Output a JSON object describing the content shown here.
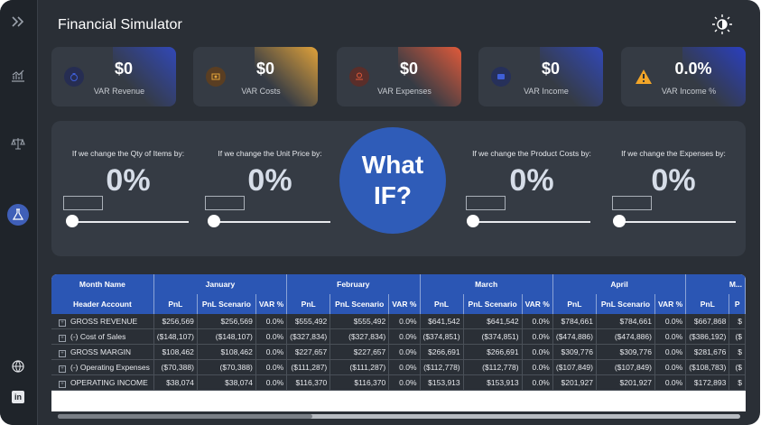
{
  "app": {
    "title": "Financial Simulator"
  },
  "sidebar": {
    "items": [
      {
        "name": "expand-icon",
        "glyph": "»"
      },
      {
        "name": "chart-icon",
        "glyph": "📈"
      },
      {
        "name": "scales-icon",
        "glyph": "⚖"
      },
      {
        "name": "flask-icon",
        "glyph": "⚗"
      },
      {
        "name": "globe-icon",
        "glyph": "🌐"
      },
      {
        "name": "linkedin-icon",
        "glyph": "in"
      }
    ]
  },
  "kpis": [
    {
      "value": "$0",
      "label": "VAR Revenue",
      "icon": "money-bag-icon",
      "accent": "#3148b8"
    },
    {
      "value": "$0",
      "label": "VAR Costs",
      "icon": "coin-icon",
      "accent": "#e0a23a"
    },
    {
      "value": "$0",
      "label": "VAR Expenses",
      "icon": "hand-coin-icon",
      "accent": "#e05a3a"
    },
    {
      "value": "$0",
      "label": "VAR Income",
      "icon": "wallet-icon",
      "accent": "#3148b8"
    },
    {
      "value": "0.0%",
      "label": "VAR Income %",
      "icon": "warning-icon",
      "accent": "#2a3fc0"
    }
  ],
  "controls": [
    {
      "question": "If we change the Qty of Items by:",
      "value": "0%"
    },
    {
      "question": "If we change the Unit Price by:",
      "value": "0%"
    },
    {
      "question": "If we change the Product Costs by:",
      "value": "0%"
    },
    {
      "question": "If we change the Expenses by:",
      "value": "0%"
    }
  ],
  "whatif": {
    "line1": "What",
    "line2": "IF?"
  },
  "table": {
    "header1_label": "Month Name",
    "header2_label": "Header Account",
    "months": [
      "January",
      "February",
      "March",
      "April",
      "M..."
    ],
    "subcols": [
      "PnL",
      "PnL Scenario",
      "VAR %"
    ],
    "rows": [
      {
        "account": "GROSS REVENUE",
        "cells": [
          "$256,569",
          "$256,569",
          "0.0%",
          "$555,492",
          "$555,492",
          "0.0%",
          "$641,542",
          "$641,542",
          "0.0%",
          "$784,661",
          "$784,661",
          "0.0%",
          "$667,868",
          "$"
        ]
      },
      {
        "account": "(-) Cost of Sales",
        "cells": [
          "($148,107)",
          "($148,107)",
          "0.0%",
          "($327,834)",
          "($327,834)",
          "0.0%",
          "($374,851)",
          "($374,851)",
          "0.0%",
          "($474,886)",
          "($474,886)",
          "0.0%",
          "($386,192)",
          "($"
        ]
      },
      {
        "account": "GROSS MARGIN",
        "cells": [
          "$108,462",
          "$108,462",
          "0.0%",
          "$227,657",
          "$227,657",
          "0.0%",
          "$266,691",
          "$266,691",
          "0.0%",
          "$309,776",
          "$309,776",
          "0.0%",
          "$281,676",
          "$"
        ]
      },
      {
        "account": "(-) Operating Expenses",
        "cells": [
          "($70,388)",
          "($70,388)",
          "0.0%",
          "($111,287)",
          "($111,287)",
          "0.0%",
          "($112,778)",
          "($112,778)",
          "0.0%",
          "($107,849)",
          "($107,849)",
          "0.0%",
          "($108,783)",
          "($"
        ]
      },
      {
        "account": "OPERATING INCOME",
        "cells": [
          "$38,074",
          "$38,074",
          "0.0%",
          "$116,370",
          "$116,370",
          "0.0%",
          "$153,913",
          "$153,913",
          "0.0%",
          "$201,927",
          "$201,927",
          "0.0%",
          "$172,893",
          "$"
        ]
      }
    ]
  },
  "colors": {
    "accent": "#2f5cb8",
    "background": "#2a2f36",
    "card": "#353b44"
  }
}
